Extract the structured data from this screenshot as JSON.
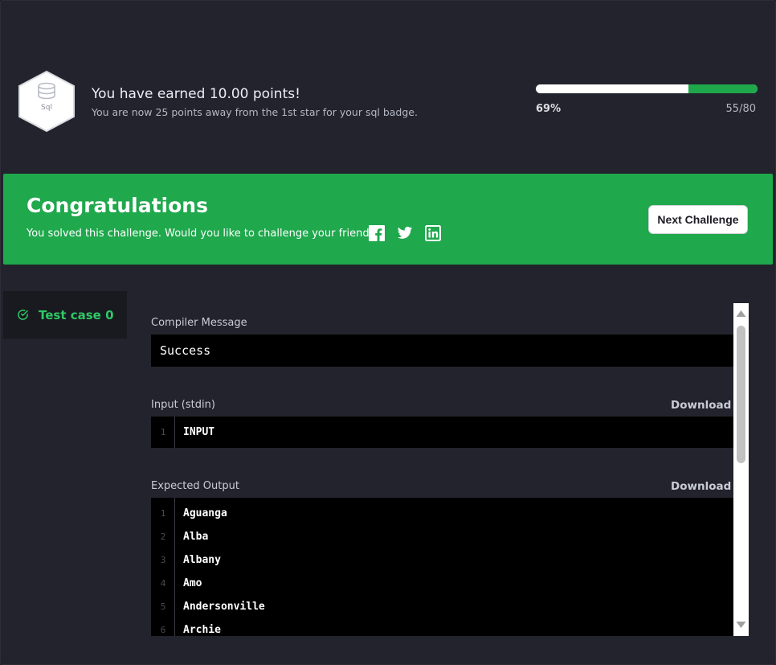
{
  "header": {
    "badge_label": "Sql",
    "earned_title": "You have earned 10.00 points!",
    "earned_subtitle": "You are now 25 points away from the 1st star for your sql badge.",
    "progress_percent_label": "69%",
    "progress_count_label": "55/80",
    "progress_fill_fraction": 0.31
  },
  "banner": {
    "title": "Congratulations",
    "subtitle": "You solved this challenge. Would you like to challenge your friends?",
    "social_icons": [
      "facebook-icon",
      "twitter-icon",
      "linkedin-icon"
    ],
    "next_button_label": "Next Challenge",
    "color": "#1fa84c"
  },
  "testcases": {
    "tab_label": "Test case 0",
    "accent_color": "#2ec866"
  },
  "compiler": {
    "label": "Compiler Message",
    "message": "Success"
  },
  "input": {
    "label": "Input (stdin)",
    "download_label": "Download",
    "lines": [
      {
        "no": "1",
        "text": "INPUT"
      }
    ]
  },
  "expected": {
    "label": "Expected Output",
    "download_label": "Download",
    "lines": [
      {
        "no": "1",
        "text": "Aguanga"
      },
      {
        "no": "2",
        "text": "Alba"
      },
      {
        "no": "3",
        "text": "Albany"
      },
      {
        "no": "4",
        "text": "Amo"
      },
      {
        "no": "5",
        "text": "Andersonville"
      },
      {
        "no": "6",
        "text": "Archie"
      }
    ]
  }
}
